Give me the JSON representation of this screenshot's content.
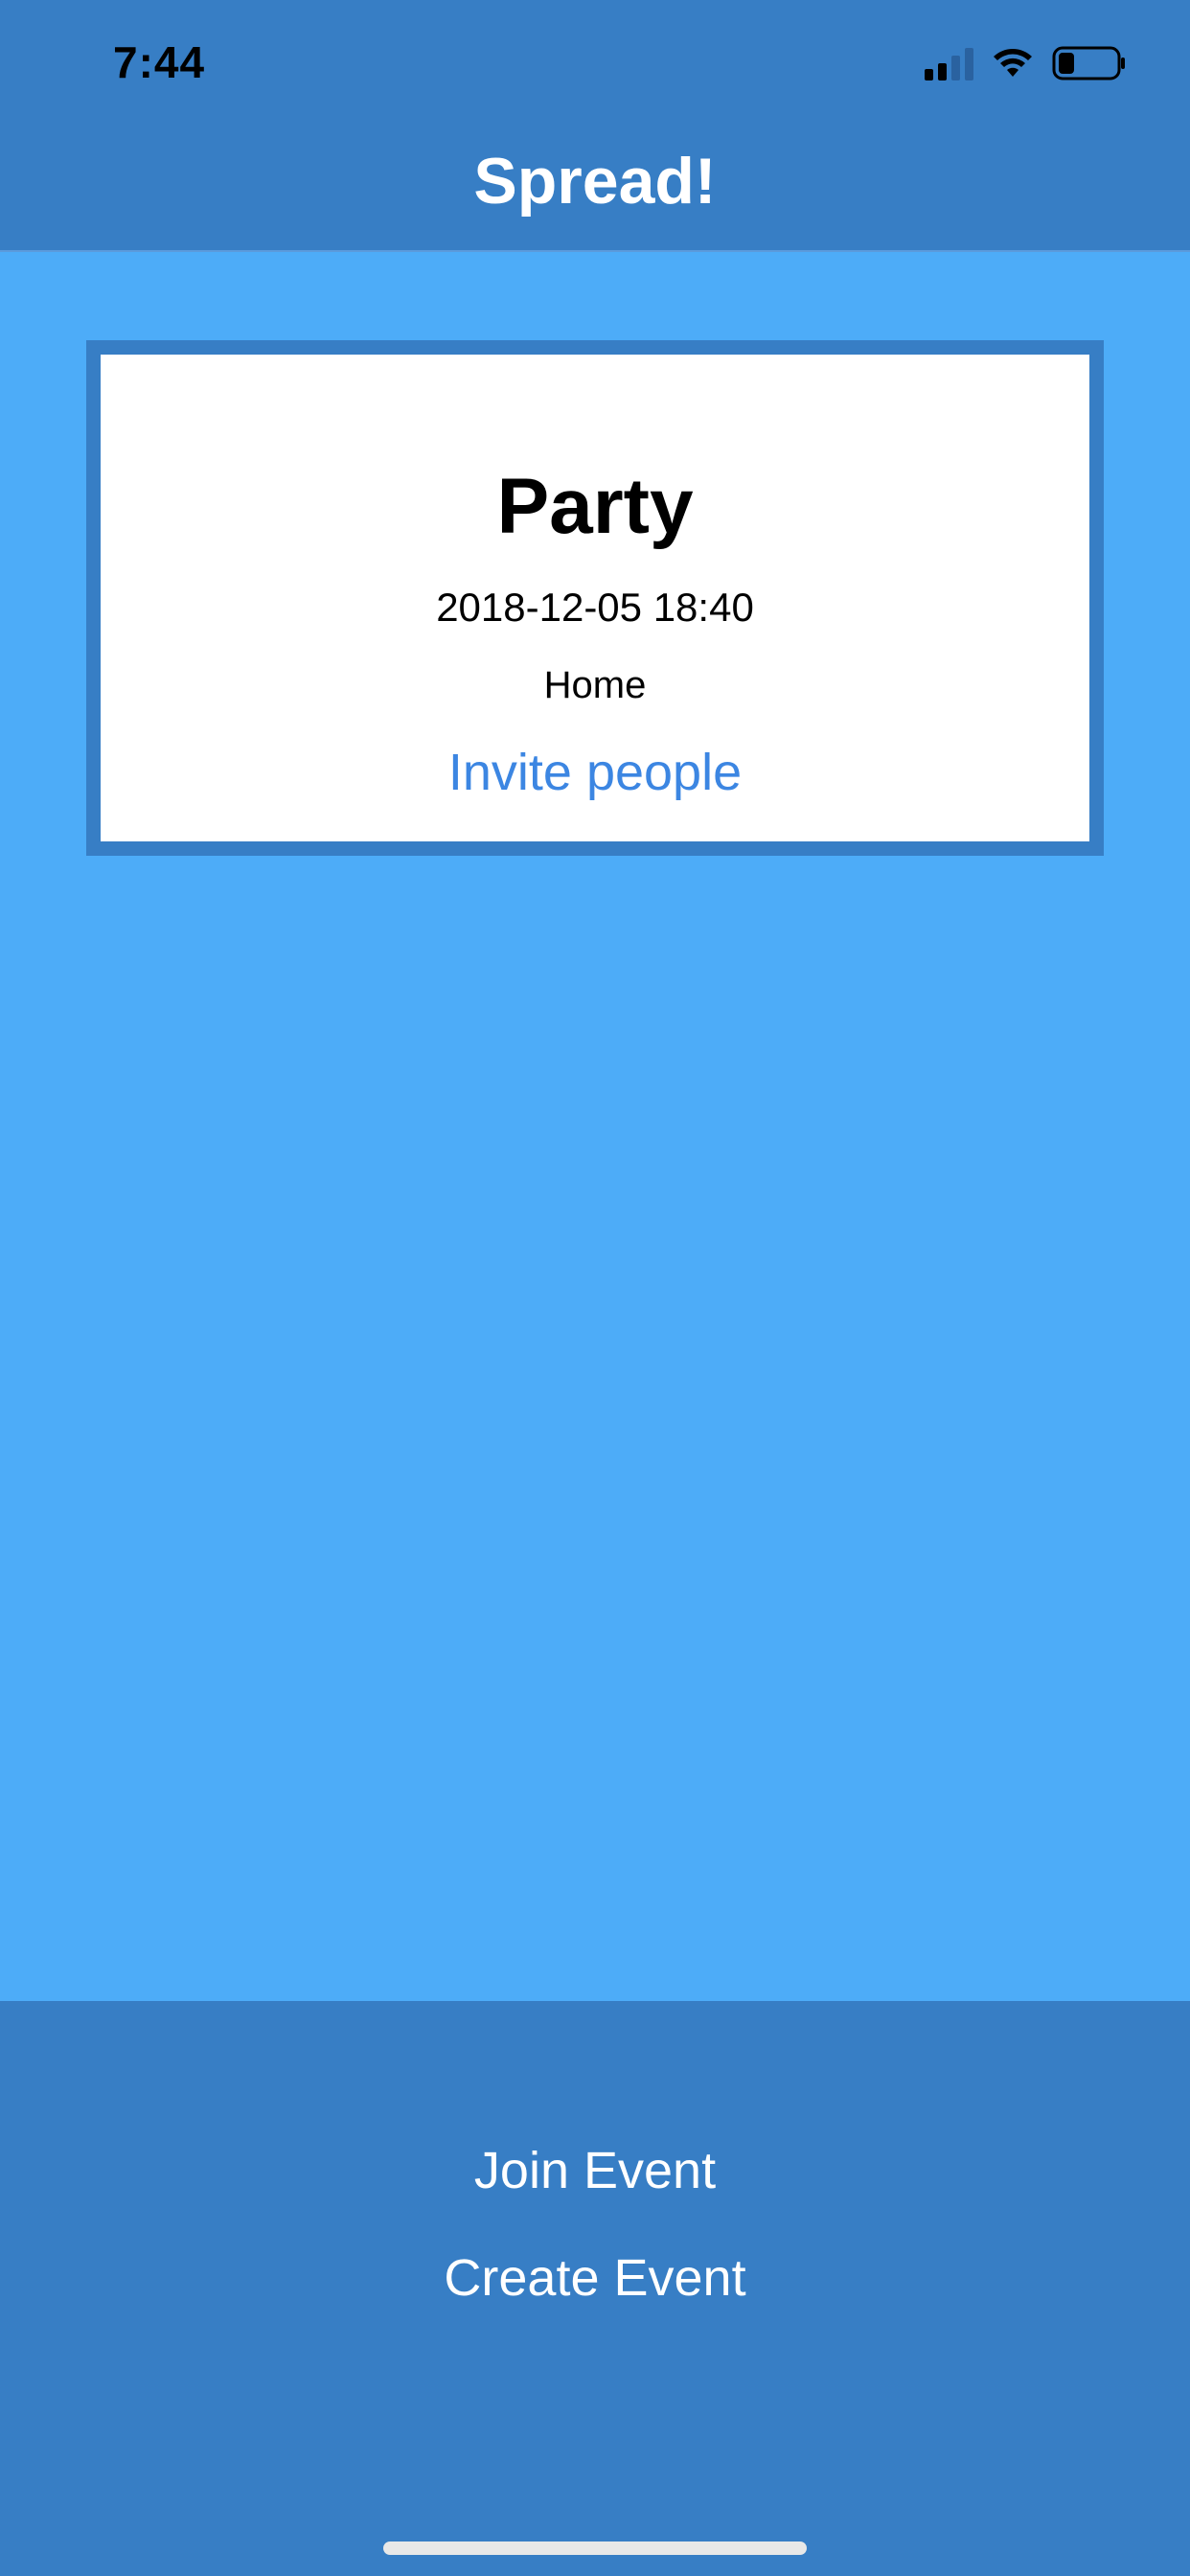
{
  "status_bar": {
    "time": "7:44",
    "icons": [
      "cellular-signal-icon",
      "wifi-icon",
      "battery-icon"
    ]
  },
  "header": {
    "title": "Spread!"
  },
  "event": {
    "title": "Party",
    "datetime": "2018-12-05 18:40",
    "location": "Home",
    "invite_label": "Invite people"
  },
  "actions": {
    "join_label": "Join Event",
    "create_label": "Create Event"
  },
  "colors": {
    "header_bg": "#377ec5",
    "content_bg": "#4dacf8",
    "card_bg": "#ffffff",
    "link": "#3c86e2"
  }
}
